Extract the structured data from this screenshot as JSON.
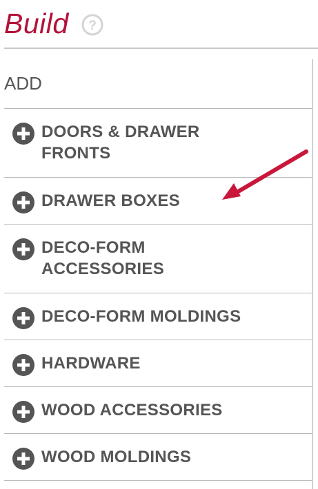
{
  "header": {
    "title": "Build",
    "help_icon": "help-circle-icon"
  },
  "add_section": {
    "label": "ADD"
  },
  "menu": {
    "items": [
      {
        "label": "DOORS & DRAWER FRONTS",
        "icon": "plus-circle-icon"
      },
      {
        "label": "DRAWER BOXES",
        "icon": "plus-circle-icon"
      },
      {
        "label": "DECO-FORM ACCESSORIES",
        "icon": "plus-circle-icon"
      },
      {
        "label": "DECO-FORM MOLDINGS",
        "icon": "plus-circle-icon"
      },
      {
        "label": "HARDWARE",
        "icon": "plus-circle-icon"
      },
      {
        "label": "WOOD ACCESSORIES",
        "icon": "plus-circle-icon"
      },
      {
        "label": "WOOD MOLDINGS",
        "icon": "plus-circle-icon"
      }
    ]
  },
  "annotation": {
    "icon": "red-pointer-arrow-icon",
    "color": "#c8173a"
  },
  "colors": {
    "title": "#b3123a",
    "text": "#555555",
    "icon": "#555555",
    "rule": "#b8b8b8"
  }
}
